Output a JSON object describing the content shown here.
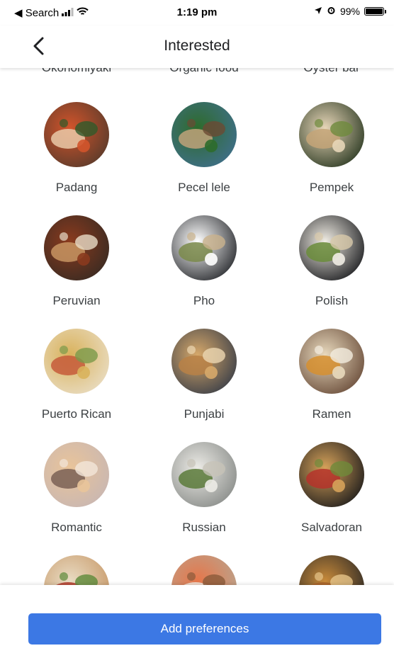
{
  "status_bar": {
    "back_app": "◀ Search",
    "time": "1:19 pm",
    "battery": "99%",
    "battery_level": 0.99
  },
  "header": {
    "title": "Interested",
    "back_icon": "chevron-left-icon"
  },
  "partial_row": [
    "Okonomiyaki",
    "Organic food",
    "Oyster bar"
  ],
  "items": [
    {
      "label": "Padang",
      "colors": [
        "#5a3b2b",
        "#d2542b",
        "#e9c9a8",
        "#2f5a2a"
      ]
    },
    {
      "label": "Pecel lele",
      "colors": [
        "#3f6f8a",
        "#2e6b2b",
        "#c0a27a",
        "#6b4a33"
      ]
    },
    {
      "label": "Pempek",
      "colors": [
        "#2d3b24",
        "#e7d6b8",
        "#c4a478",
        "#6e8a3c"
      ]
    },
    {
      "label": "Peruvian",
      "colors": [
        "#3a2b22",
        "#8a3a1e",
        "#c89563",
        "#e8dcc7"
      ]
    },
    {
      "label": "Pho",
      "colors": [
        "#2a2c30",
        "#ffffff",
        "#7a8a4a",
        "#c9b28c"
      ]
    },
    {
      "label": "Polish",
      "colors": [
        "#1e1f22",
        "#f1ede4",
        "#6a8c3a",
        "#d8c9aa"
      ]
    },
    {
      "label": "Puerto Rican",
      "colors": [
        "#e9dcc1",
        "#d9b25c",
        "#c65a3a",
        "#7a9a4a"
      ]
    },
    {
      "label": "Punjabi",
      "colors": [
        "#3b3f48",
        "#d6a86a",
        "#b98146",
        "#ecd7b2"
      ]
    },
    {
      "label": "Ramen",
      "colors": [
        "#6b4e3b",
        "#e8d9bd",
        "#d68f2f",
        "#f3ecdf"
      ]
    },
    {
      "label": "Romantic",
      "colors": [
        "#c9b7b2",
        "#e9c49a",
        "#7a6055",
        "#f2e6da"
      ]
    },
    {
      "label": "Russian",
      "colors": [
        "#8a8d8a",
        "#ecebe6",
        "#5a7a3a",
        "#c7c3b8"
      ]
    },
    {
      "label": "Salvadoran",
      "colors": [
        "#1f1d1c",
        "#d6a25a",
        "#b5322a",
        "#6f8a3a"
      ]
    },
    {
      "label": "",
      "colors": [
        "#c89a6a",
        "#e9dcc4",
        "#b23a2a",
        "#5c8a3a"
      ]
    },
    {
      "label": "",
      "colors": [
        "#b9a48e",
        "#e6764a",
        "#f1e8de",
        "#8a5a3a"
      ]
    },
    {
      "label": "",
      "colors": [
        "#2e2a26",
        "#c98b3a",
        "#a8632a",
        "#e6c48a"
      ]
    }
  ],
  "add_button": {
    "label": "Add preferences",
    "color": "#3c78e4"
  }
}
